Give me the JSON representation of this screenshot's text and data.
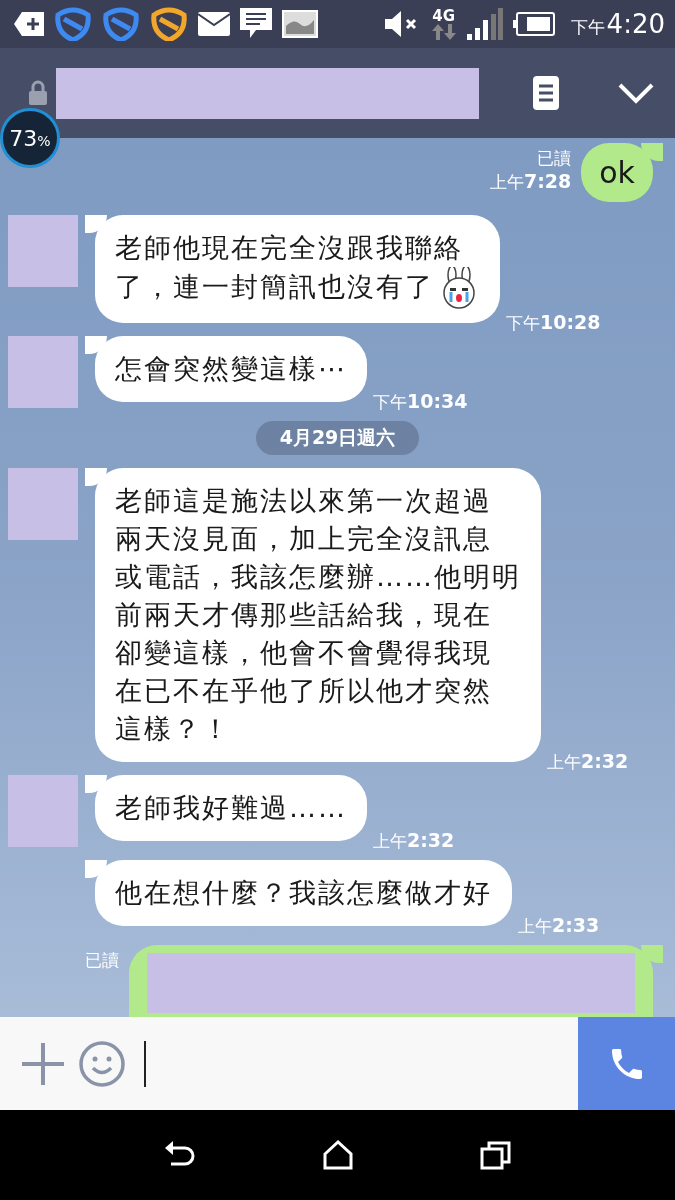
{
  "status_bar": {
    "network": "4G",
    "period": "下午",
    "clock": "4:20"
  },
  "memory_badge": {
    "value": "73",
    "unit": "%"
  },
  "messages": [
    {
      "kind": "outgoing",
      "text": "ok",
      "read": "已讀",
      "time": "上午**7:28**"
    },
    {
      "kind": "incoming",
      "avatar": true,
      "lines": [
        "老師他現在完全沒跟我聯絡",
        "了，連一封簡訊也沒有了"
      ],
      "sticker": true,
      "time": "下午**10:28**"
    },
    {
      "kind": "incoming",
      "avatar": true,
      "lines": [
        "怎會突然變這樣⋯"
      ],
      "sticker": false,
      "time": "下午**10:34**"
    },
    {
      "kind": "date",
      "text": "4月29日週六"
    },
    {
      "kind": "incoming",
      "avatar": true,
      "lines": [
        "老師這是施法以來第一次超過",
        "兩天沒見面，加上完全沒訊息",
        "或電話，我該怎麼辦……他明明",
        "前兩天才傳那些話給我，現在",
        "卻變這樣，他會不會覺得我現",
        "在已不在乎他了所以他才突然",
        "這樣？！"
      ],
      "sticker": false,
      "time": "上午**2:32**"
    },
    {
      "kind": "incoming",
      "avatar": true,
      "lines": [
        "老師我好難過……"
      ],
      "sticker": false,
      "time": "上午**2:32**"
    },
    {
      "kind": "incoming",
      "avatar": false,
      "lines": [
        "他在想什麼？我該怎麼做才好"
      ],
      "sticker": false,
      "time": "上午**2:33**"
    },
    {
      "kind": "outgoing",
      "redacted": true,
      "read": "已讀"
    }
  ]
}
